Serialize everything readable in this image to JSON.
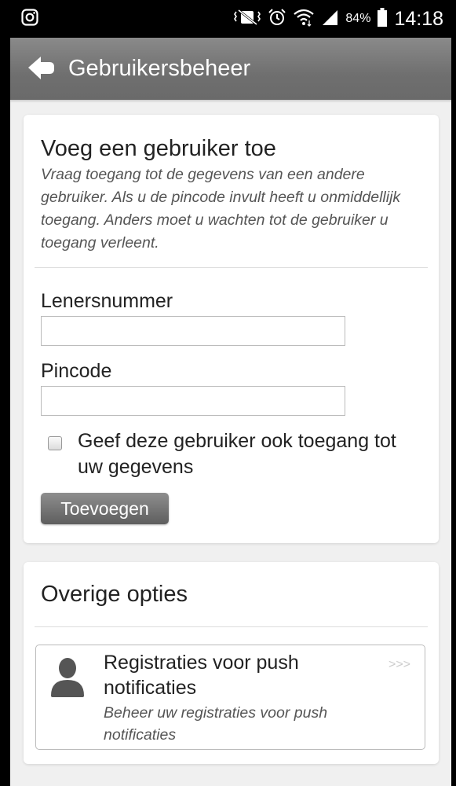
{
  "status_bar": {
    "icons": [
      "instagram-icon",
      "vibrate-icon",
      "alarm-icon",
      "wifi-icon",
      "signal-icon",
      "battery-icon"
    ],
    "battery": "84%",
    "time": "14:18"
  },
  "app_bar": {
    "title": "Gebruikersbeheer",
    "back_icon": "back-arrow-icon"
  },
  "add_user": {
    "title": "Voeg een gebruiker toe",
    "description": "Vraag toegang tot de gegevens van een andere gebruiker. Als u de pincode invult heeft u onmiddellijk toegang. Anders moet u wachten tot de gebruiker u toegang verleent.",
    "leners_label": "Lenersnummer",
    "leners_value": "",
    "pincode_label": "Pincode",
    "pincode_value": "",
    "grant_access_label": "Geef deze gebruiker ook toegang tot uw gegevens",
    "grant_access_checked": false,
    "submit_label": "Toevoegen"
  },
  "other_options": {
    "title": "Overige opties",
    "items": [
      {
        "icon": "person-icon",
        "title": "Registraties voor push notificaties",
        "subtitle": "Beheer uw registraties voor push notificaties",
        "arrow": ">>>"
      }
    ]
  },
  "colors": {
    "app_bar": "#7a7a7a",
    "background": "#f0f0f0",
    "card": "#ffffff",
    "button": "#777777"
  }
}
